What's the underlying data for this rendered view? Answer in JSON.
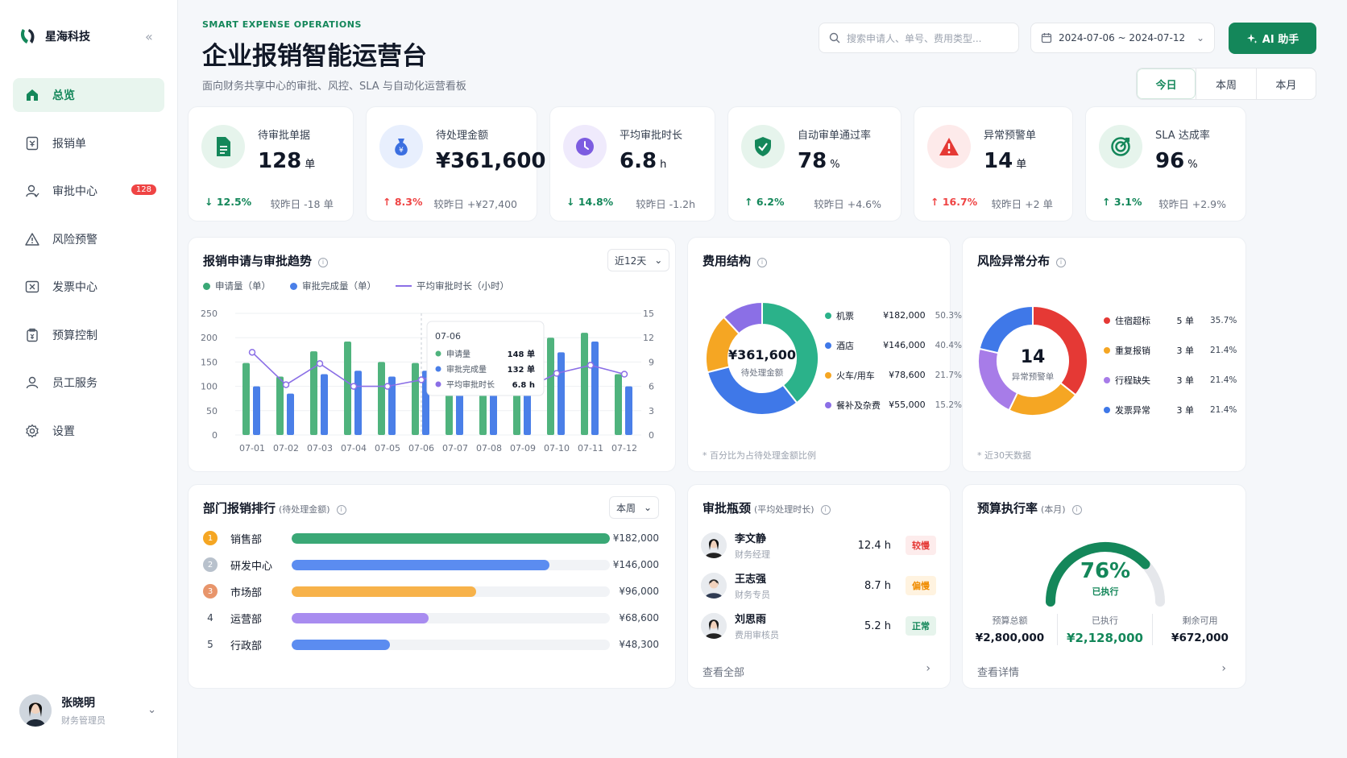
{
  "app": {
    "brand": "星海科技"
  },
  "sidebar": {
    "items": [
      {
        "label": "总览",
        "icon": "home-icon"
      },
      {
        "label": "报销单",
        "icon": "receipt-icon"
      },
      {
        "label": "审批中心",
        "icon": "user-check-icon",
        "badge": "128"
      },
      {
        "label": "风险预警",
        "icon": "warning-icon"
      },
      {
        "label": "发票中心",
        "icon": "invoice-icon"
      },
      {
        "label": "预算控制",
        "icon": "budget-icon"
      },
      {
        "label": "员工服务",
        "icon": "user-icon"
      },
      {
        "label": "设置",
        "icon": "gear-icon"
      }
    ]
  },
  "user": {
    "name": "张晓明",
    "role": "财务管理员"
  },
  "header": {
    "eyebrow": "SMART EXPENSE OPERATIONS",
    "title": "企业报销智能运营台",
    "subtitle": "面向财务共享中心的审批、风控、SLA 与自动化运营看板",
    "search_placeholder": "搜索申请人、单号、费用类型...",
    "date_range": "2024-07-06 ~ 2024-07-12",
    "ai_label": "AI 助手",
    "periods": [
      "今日",
      "本周",
      "本月"
    ]
  },
  "kpis": [
    {
      "label": "待审批单据",
      "value": "128",
      "unit": "单",
      "trend": "↓ 12.5%",
      "compare": "较昨日 -18 单",
      "color": "#14875a",
      "bg": "#e6f4ec"
    },
    {
      "label": "待处理金额",
      "value": "¥361,600",
      "unit": "",
      "trend": "↑ 8.3%",
      "compare": "较昨日 +¥27,400",
      "color": "#3b6fe0",
      "bg": "#e8effd"
    },
    {
      "label": "平均审批时长",
      "value": "6.8",
      "unit": "h",
      "trend": "↓ 14.8%",
      "compare": "较昨日 -1.2h",
      "color": "#7c5ce0",
      "bg": "#efeafc"
    },
    {
      "label": "自动审单通过率",
      "value": "78",
      "unit": "%",
      "trend": "↑ 6.2%",
      "compare": "较昨日 +4.6%",
      "color": "#14875a",
      "bg": "#e6f4ec"
    },
    {
      "label": "异常预警单",
      "value": "14",
      "unit": "单",
      "trend": "↑ 16.7%",
      "compare": "较昨日 +2 单",
      "color": "#e53935",
      "bg": "#fdeaea"
    },
    {
      "label": "SLA 达成率",
      "value": "96",
      "unit": "%",
      "trend": "↑ 3.1%",
      "compare": "较昨日 +2.9%",
      "color": "#14875a",
      "bg": "#e6f4ec"
    }
  ],
  "trend_card": {
    "title": "报销申请与审批趋势",
    "range_select": "近12天",
    "legend": [
      "申请量（单）",
      "审批完成量（单）",
      "平均审批时长（小时）"
    ],
    "tooltip": {
      "date": "07-06",
      "rows": [
        {
          "k": "申请量",
          "v": "148 单"
        },
        {
          "k": "审批完成量",
          "v": "132 单"
        },
        {
          "k": "平均审批时长",
          "v": "6.8 h"
        }
      ]
    }
  },
  "chart_data": [
    {
      "type": "bar",
      "title": "报销申请与审批趋势",
      "categories": [
        "07-01",
        "07-02",
        "07-03",
        "07-04",
        "07-05",
        "07-06",
        "07-07",
        "07-08",
        "07-09",
        "07-10",
        "07-11",
        "07-12"
      ],
      "y_ticks": [
        "250",
        "200",
        "150",
        "100",
        "50",
        "0"
      ],
      "y2_ticks": [
        "15",
        "12",
        "9",
        "6",
        "3",
        "0"
      ],
      "ylim": [
        0,
        250
      ],
      "y2lim": [
        0,
        15
      ],
      "series": [
        {
          "name": "申请量（单）",
          "type": "bar",
          "color": "#4fb37d",
          "values": [
            148,
            120,
            172,
            192,
            150,
            148,
            155,
            165,
            178,
            200,
            210,
            125
          ]
        },
        {
          "name": "审批完成量（单）",
          "type": "bar",
          "color": "#4a7fe8",
          "values": [
            100,
            85,
            125,
            132,
            120,
            132,
            128,
            135,
            110,
            170,
            192,
            100
          ]
        },
        {
          "name": "平均审批时长（小时）",
          "type": "line",
          "axis": "right",
          "color": "#8b6fe6",
          "values": [
            10.2,
            6.2,
            8.8,
            6.0,
            6.0,
            6.8,
            8.0,
            7.2,
            5.5,
            7.6,
            8.6,
            7.5
          ]
        }
      ]
    },
    {
      "type": "pie",
      "title": "费用结构",
      "center_value": "¥361,600",
      "center_label": "待处理金额",
      "slices": [
        {
          "label": "机票",
          "value": 182000,
          "display": "¥182,000",
          "pct": "50.3%",
          "color": "#2bb28a"
        },
        {
          "label": "酒店",
          "value": 146000,
          "display": "¥146,000",
          "pct": "40.4%",
          "color": "#3f78e8"
        },
        {
          "label": "火车/用车",
          "value": 78600,
          "display": "¥78,600",
          "pct": "21.7%",
          "color": "#f5a623"
        },
        {
          "label": "餐补及杂费",
          "value": 55000,
          "display": "¥55,000",
          "pct": "15.2%",
          "color": "#8b6fe6"
        }
      ],
      "note": "* 百分比为占待处理金额比例"
    },
    {
      "type": "pie",
      "title": "风险异常分布",
      "center_value": "14",
      "center_label": "异常预警单",
      "slices": [
        {
          "label": "住宿超标",
          "value": 5,
          "display": "5 单",
          "pct": "35.7%",
          "color": "#e53935"
        },
        {
          "label": "重复报销",
          "value": 3,
          "display": "3 单",
          "pct": "21.4%",
          "color": "#f5a623"
        },
        {
          "label": "行程缺失",
          "value": 3,
          "display": "3 单",
          "pct": "21.4%",
          "color": "#a77ce8"
        },
        {
          "label": "发票异常",
          "value": 3,
          "display": "3 单",
          "pct": "21.4%",
          "color": "#3f78e8"
        }
      ],
      "note": "* 近30天数据"
    }
  ],
  "ranking": {
    "title": "部门报销排行",
    "subtitle": "(待处理金额)",
    "select": "本周",
    "rows": [
      {
        "rank": "1",
        "name": "销售部",
        "amount": "¥182,000",
        "fraction": 1.0,
        "color": "#3aa876",
        "badge": "#f5a623"
      },
      {
        "rank": "2",
        "name": "研发中心",
        "amount": "¥146,000",
        "fraction": 0.81,
        "color": "#5b8cf0",
        "badge": "#b8c1cc"
      },
      {
        "rank": "3",
        "name": "市场部",
        "amount": "¥96,000",
        "fraction": 0.58,
        "color": "#f7b24a",
        "badge": "#e8956b"
      },
      {
        "rank": "4",
        "name": "运营部",
        "amount": "¥68,600",
        "fraction": 0.43,
        "color": "#a88cf0",
        "badge": ""
      },
      {
        "rank": "5",
        "name": "行政部",
        "amount": "¥48,300",
        "fraction": 0.31,
        "color": "#5b8cf0",
        "badge": ""
      }
    ]
  },
  "bottleneck": {
    "title": "审批瓶颈",
    "subtitle": "(平均处理时长)",
    "rows": [
      {
        "name": "李文静",
        "role": "财务经理",
        "time": "12.4 h",
        "tag": "较慢",
        "tag_color": "#e53935",
        "tag_bg": "#fdecec"
      },
      {
        "name": "王志强",
        "role": "财务专员",
        "time": "8.7 h",
        "tag": "偏慢",
        "tag_color": "#f08c00",
        "tag_bg": "#fff3e0"
      },
      {
        "name": "刘思雨",
        "role": "费用审核员",
        "time": "5.2 h",
        "tag": "正常",
        "tag_color": "#14875a",
        "tag_bg": "#e6f4ec"
      }
    ],
    "more": "查看全部"
  },
  "budget": {
    "title": "预算执行率",
    "subtitle": "(本月)",
    "percent": "76%",
    "percent_value": 0.76,
    "percent_label": "已执行",
    "stats": [
      {
        "label": "预算总额",
        "value": "¥2,800,000"
      },
      {
        "label": "已执行",
        "value": "¥2,128,000"
      },
      {
        "label": "剩余可用",
        "value": "¥672,000"
      }
    ],
    "more": "查看详情"
  }
}
